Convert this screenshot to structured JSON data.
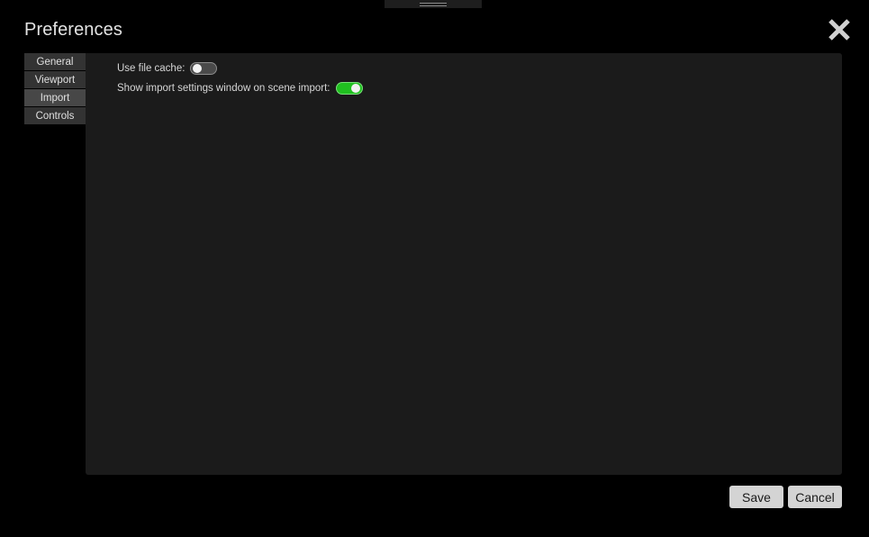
{
  "dialog": {
    "title": "Preferences",
    "close_icon": "close-x-icon"
  },
  "sidebar": {
    "tabs": [
      {
        "label": "General",
        "active": false
      },
      {
        "label": "Viewport",
        "active": false
      },
      {
        "label": "Import",
        "active": true
      },
      {
        "label": "Controls",
        "active": false
      }
    ]
  },
  "settings": {
    "use_file_cache": {
      "label": "Use file cache:",
      "enabled": false
    },
    "show_import_window": {
      "label": "Show import settings window on scene import:",
      "enabled": true
    }
  },
  "footer": {
    "save_label": "Save",
    "cancel_label": "Cancel"
  },
  "colors": {
    "toggle_on": "#20c020",
    "toggle_off": "#4a4a4a",
    "panel_bg": "#1b1b1b",
    "button_bg": "#d4d4d4"
  }
}
